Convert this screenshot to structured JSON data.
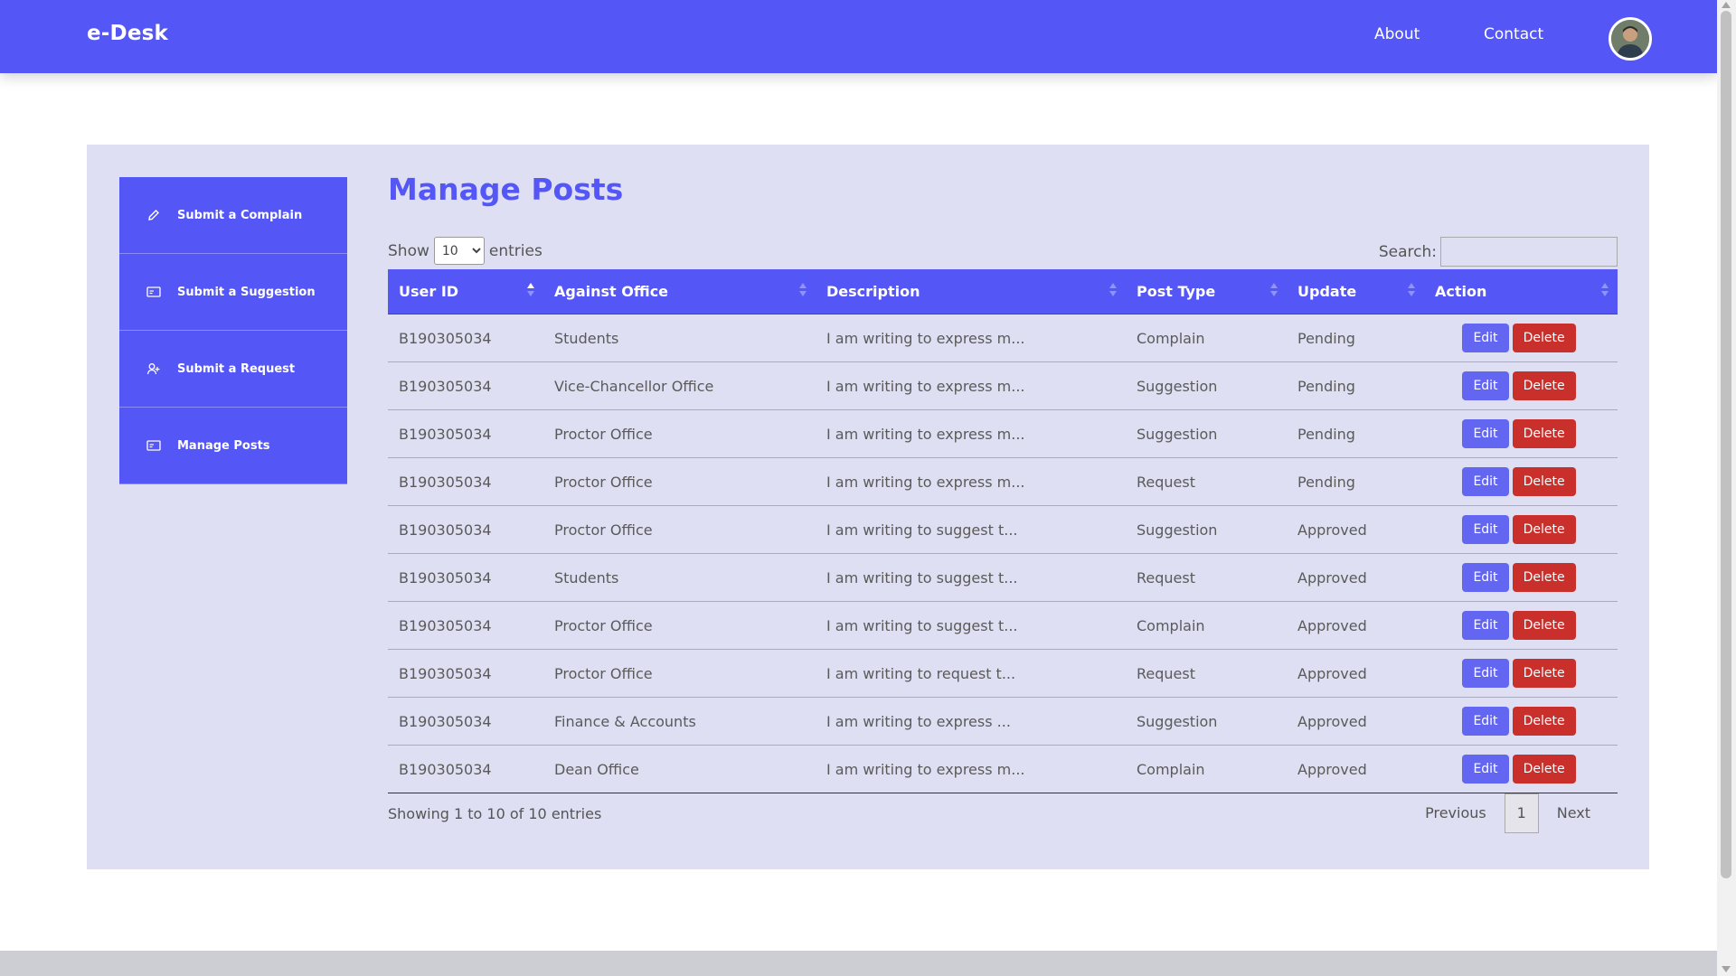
{
  "header": {
    "brand": "e-Desk",
    "nav": [
      {
        "label": "About"
      },
      {
        "label": "Contact"
      }
    ]
  },
  "sidebar": {
    "items": [
      {
        "label": "Submit a Complain",
        "icon": "pencil-icon"
      },
      {
        "label": "Submit a Suggestion",
        "icon": "card-icon"
      },
      {
        "label": "Submit a Request",
        "icon": "user-add-icon"
      },
      {
        "label": "Manage Posts",
        "icon": "card-icon"
      }
    ]
  },
  "main": {
    "title": "Manage Posts",
    "show_label": "Show",
    "entries_label": "entries",
    "page_length": "10",
    "search_label": "Search:",
    "search_value": "",
    "columns": [
      "User ID",
      "Against Office",
      "Description",
      "Post Type",
      "Update",
      "Action"
    ],
    "rows": [
      {
        "user_id": "B190305034",
        "office": "Students",
        "description": "I am writing to express m...",
        "type": "Complain",
        "update": "Pending"
      },
      {
        "user_id": "B190305034",
        "office": "Vice-Chancellor Office",
        "description": "I am writing to express m...",
        "type": "Suggestion",
        "update": "Pending"
      },
      {
        "user_id": "B190305034",
        "office": "Proctor Office",
        "description": "I am writing to express m...",
        "type": "Suggestion",
        "update": "Pending"
      },
      {
        "user_id": "B190305034",
        "office": "Proctor Office",
        "description": "I am writing to express m...",
        "type": "Request",
        "update": "Pending"
      },
      {
        "user_id": "B190305034",
        "office": "Proctor Office",
        "description": "I am writing to suggest t...",
        "type": "Suggestion",
        "update": "Approved"
      },
      {
        "user_id": "B190305034",
        "office": "Students",
        "description": "I am writing to suggest t...",
        "type": "Request",
        "update": "Approved"
      },
      {
        "user_id": "B190305034",
        "office": "Proctor Office",
        "description": "I am writing to suggest t...",
        "type": "Complain",
        "update": "Approved"
      },
      {
        "user_id": "B190305034",
        "office": "Proctor Office",
        "description": "I am writing to request t...",
        "type": "Request",
        "update": "Approved"
      },
      {
        "user_id": "B190305034",
        "office": "Finance & Accounts",
        "description": "I am writing to express ...",
        "type": "Suggestion",
        "update": "Approved"
      },
      {
        "user_id": "B190305034",
        "office": "Dean Office",
        "description": "I am writing to express m...",
        "type": "Complain",
        "update": "Approved"
      }
    ],
    "edit_label": "Edit",
    "delete_label": "Delete",
    "info": "Showing 1 to 10 of 10 entries",
    "pagination": {
      "previous": "Previous",
      "current": "1",
      "next": "Next"
    }
  },
  "colors": {
    "primary": "#5457f5",
    "panel": "#dfdff3",
    "edit": "#6366f1",
    "delete": "#c9302c"
  }
}
